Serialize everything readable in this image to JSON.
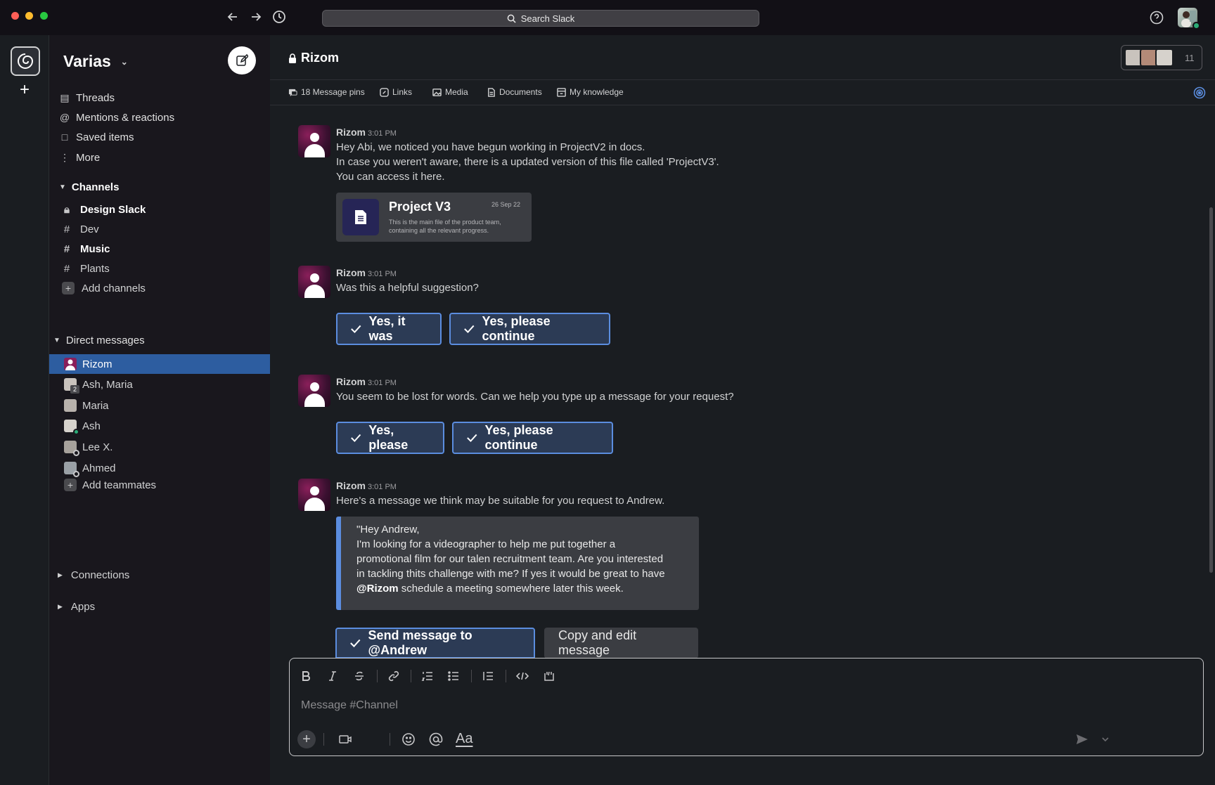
{
  "search": {
    "label": "Search Slack"
  },
  "workspace": {
    "name": "Varias"
  },
  "sidebar": {
    "nav": [
      {
        "label": "Threads",
        "icon": "threads-icon"
      },
      {
        "label": "Mentions & reactions",
        "icon": "at-icon"
      },
      {
        "label": "Saved items",
        "icon": "bookmark-icon"
      },
      {
        "label": "More",
        "icon": "more-vertical-icon"
      }
    ],
    "channels_title": "Channels",
    "channels": [
      {
        "name": "Design Slack",
        "icon": "lock-icon"
      },
      {
        "name": "Dev",
        "icon": "hash-icon"
      },
      {
        "name": "Music",
        "icon": "hash-icon"
      },
      {
        "name": "Plants",
        "icon": "hash-icon"
      }
    ],
    "add_channels": "Add channels",
    "dm_title": "Direct messages",
    "dms": [
      {
        "name": "Rizom",
        "active": true
      },
      {
        "name": "Ash, Maria",
        "badge": "2"
      },
      {
        "name": "Maria"
      },
      {
        "name": "Ash",
        "status": "online"
      },
      {
        "name": "Lee X.",
        "status": "away"
      },
      {
        "name": "Ahmed",
        "status": "away"
      }
    ],
    "add_teammates": "Add teammates",
    "connections": "Connections",
    "apps": "Apps"
  },
  "channel": {
    "name": "Rizom",
    "member_count": "11",
    "tabs": [
      {
        "label": "18 Message pins",
        "icon": "pin-icon"
      },
      {
        "label": "Links",
        "icon": "link-icon"
      },
      {
        "label": "Media",
        "icon": "image-icon"
      },
      {
        "label": "Documents",
        "icon": "document-icon"
      },
      {
        "label": "My knowledge",
        "icon": "knowledge-icon"
      }
    ]
  },
  "messages": [
    {
      "author": "Rizom",
      "time": "3:01 PM",
      "lines": [
        "Hey Abi, we noticed you have begun working in ProjectV2 in docs.",
        "In case you weren't aware, there is a updated version of this file called 'ProjectV3'.",
        "You can access it here."
      ],
      "file": {
        "title": "Project V3",
        "date": "26 Sep 22",
        "desc": "This is the main file of the product team, containing all the relevant progress."
      }
    },
    {
      "author": "Rizom",
      "time": "3:01 PM",
      "lines": [
        "Was this a helpful suggestion?"
      ],
      "buttons": [
        "Yes, it was",
        "Yes, please continue"
      ]
    },
    {
      "author": "Rizom",
      "time": "3:01 PM",
      "lines": [
        "You seem to be lost for words. Can we help you type up a message for your request?"
      ],
      "buttons": [
        "Yes, please",
        "Yes, please continue"
      ]
    },
    {
      "author": "Rizom",
      "time": "3:01 PM",
      "lines": [
        "Here's a message we think may be suitable for you request to Andrew."
      ],
      "quote": {
        "line1": "\"Hey Andrew,",
        "line2": "I'm looking for a videographer to help me put together a",
        "line3": "promotional film for our talen recruitment team. Are you interested",
        "line4": "in tackling thits challenge with me? If yes it would be great to have",
        "mention": "@Rizom",
        "line5_rest": " schedule a meeting somewhere later this week."
      },
      "primary_button": "Send message to @Andrew",
      "secondary_button": "Copy and edit message"
    }
  ],
  "composer": {
    "placeholder": "Message #Channel",
    "format_label": "Aa"
  },
  "colors": {
    "accent": "#5b8ddf",
    "active_row": "#2d5da0",
    "online": "#2bac76"
  }
}
